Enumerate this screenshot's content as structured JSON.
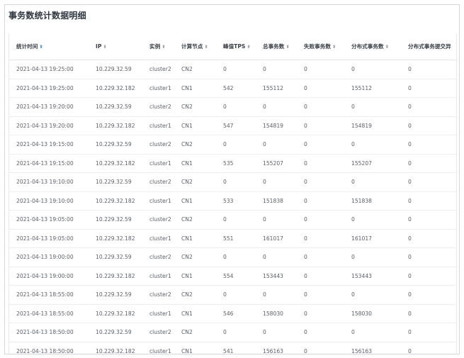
{
  "page_title": "事务数统计数据明细",
  "accent_color": "#4a90e2",
  "columns": [
    {
      "label": "统计时间",
      "sort_icon": "sort-icon",
      "active": true
    },
    {
      "label": "IP",
      "sort_icon": "sort-icon",
      "active": false
    },
    {
      "label": "实例",
      "sort_icon": "sort-icon",
      "active": false
    },
    {
      "label": "计算节点",
      "sort_icon": "sort-icon",
      "active": false
    },
    {
      "label": "峰值TPS",
      "sort_icon": "sort-icon",
      "active": false
    },
    {
      "label": "总事务数",
      "sort_icon": "sort-icon",
      "active": false
    },
    {
      "label": "失败事务数",
      "sort_icon": "sort-icon",
      "active": false
    },
    {
      "label": "分布式事务数",
      "sort_icon": "sort-icon",
      "active": false
    },
    {
      "label": "分布式事务提交异",
      "sort_icon": "",
      "active": false
    }
  ],
  "rows": [
    [
      "2021-04-13 19:25:00",
      "10.229.32.59",
      "cluster2",
      "CN2",
      "0",
      "0",
      "0",
      "0",
      "0"
    ],
    [
      "2021-04-13 19:25:00",
      "10.229.32.182",
      "cluster1",
      "CN1",
      "542",
      "155112",
      "0",
      "155112",
      "0"
    ],
    [
      "2021-04-13 19:20:00",
      "10.229.32.59",
      "cluster2",
      "CN2",
      "0",
      "0",
      "0",
      "0",
      "0"
    ],
    [
      "2021-04-13 19:20:00",
      "10.229.32.182",
      "cluster1",
      "CN1",
      "547",
      "154819",
      "0",
      "154819",
      "0"
    ],
    [
      "2021-04-13 19:15:00",
      "10.229.32.59",
      "cluster2",
      "CN2",
      "0",
      "0",
      "0",
      "0",
      "0"
    ],
    [
      "2021-04-13 19:15:00",
      "10.229.32.182",
      "cluster1",
      "CN1",
      "535",
      "155207",
      "0",
      "155207",
      "0"
    ],
    [
      "2021-04-13 19:10:00",
      "10.229.32.59",
      "cluster2",
      "CN2",
      "0",
      "0",
      "0",
      "0",
      "0"
    ],
    [
      "2021-04-13 19:10:00",
      "10.229.32.182",
      "cluster1",
      "CN1",
      "533",
      "151838",
      "0",
      "151838",
      "0"
    ],
    [
      "2021-04-13 19:05:00",
      "10.229.32.59",
      "cluster2",
      "CN2",
      "0",
      "0",
      "0",
      "0",
      "0"
    ],
    [
      "2021-04-13 19:05:00",
      "10.229.32.182",
      "cluster1",
      "CN1",
      "551",
      "161017",
      "0",
      "161017",
      "0"
    ],
    [
      "2021-04-13 19:00:00",
      "10.229.32.59",
      "cluster2",
      "CN2",
      "0",
      "0",
      "0",
      "0",
      "0"
    ],
    [
      "2021-04-13 19:00:00",
      "10.229.32.182",
      "cluster1",
      "CN1",
      "554",
      "153443",
      "0",
      "153443",
      "0"
    ],
    [
      "2021-04-13 18:55:00",
      "10.229.32.59",
      "cluster2",
      "CN2",
      "0",
      "0",
      "0",
      "0",
      "0"
    ],
    [
      "2021-04-13 18:55:00",
      "10.229.32.182",
      "cluster1",
      "CN1",
      "546",
      "158030",
      "0",
      "158030",
      "0"
    ],
    [
      "2021-04-13 18:50:00",
      "10.229.32.59",
      "cluster2",
      "CN2",
      "0",
      "0",
      "0",
      "0",
      "0"
    ],
    [
      "2021-04-13 18:50:00",
      "10.229.32.182",
      "cluster1",
      "CN1",
      "541",
      "156163",
      "0",
      "156163",
      "0"
    ]
  ]
}
